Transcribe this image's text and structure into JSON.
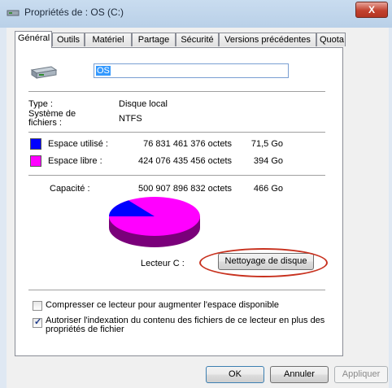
{
  "window": {
    "title": "Propriétés de : OS (C:)",
    "close_label": "X"
  },
  "tabs": [
    {
      "label": "Général"
    },
    {
      "label": "Outils"
    },
    {
      "label": "Matériel"
    },
    {
      "label": "Partage"
    },
    {
      "label": "Sécurité"
    },
    {
      "label": "Versions précédentes"
    },
    {
      "label": "Quota"
    }
  ],
  "general": {
    "drive_name": "OS",
    "type_label": "Type :",
    "type_value": "Disque local",
    "fs_label": "Système de fichiers :",
    "fs_value": "NTFS",
    "used": {
      "label": "Espace utilisé :",
      "bytes": "76 831 461 376 octets",
      "size": "71,5 Go",
      "color": "#0000ff"
    },
    "free": {
      "label": "Espace libre :",
      "bytes": "424 076 435 456 octets",
      "size": "394 Go",
      "color": "#ff00ff"
    },
    "capacity": {
      "label": "Capacité :",
      "bytes": "500 907 896 832 octets",
      "size": "466 Go"
    },
    "used_fraction": 0.153,
    "drive_label": "Lecteur C :",
    "cleanup_button": "Nettoyage de disque",
    "compress_checkbox": {
      "label": "Compresser ce lecteur pour augmenter l'espace disponible",
      "checked": false
    },
    "index_checkbox": {
      "label": "Autoriser l'indexation du contenu des fichiers de ce lecteur en plus des propriétés de fichier",
      "checked": true
    }
  },
  "buttons": {
    "ok": "OK",
    "cancel": "Annuler",
    "apply": "Appliquer"
  }
}
